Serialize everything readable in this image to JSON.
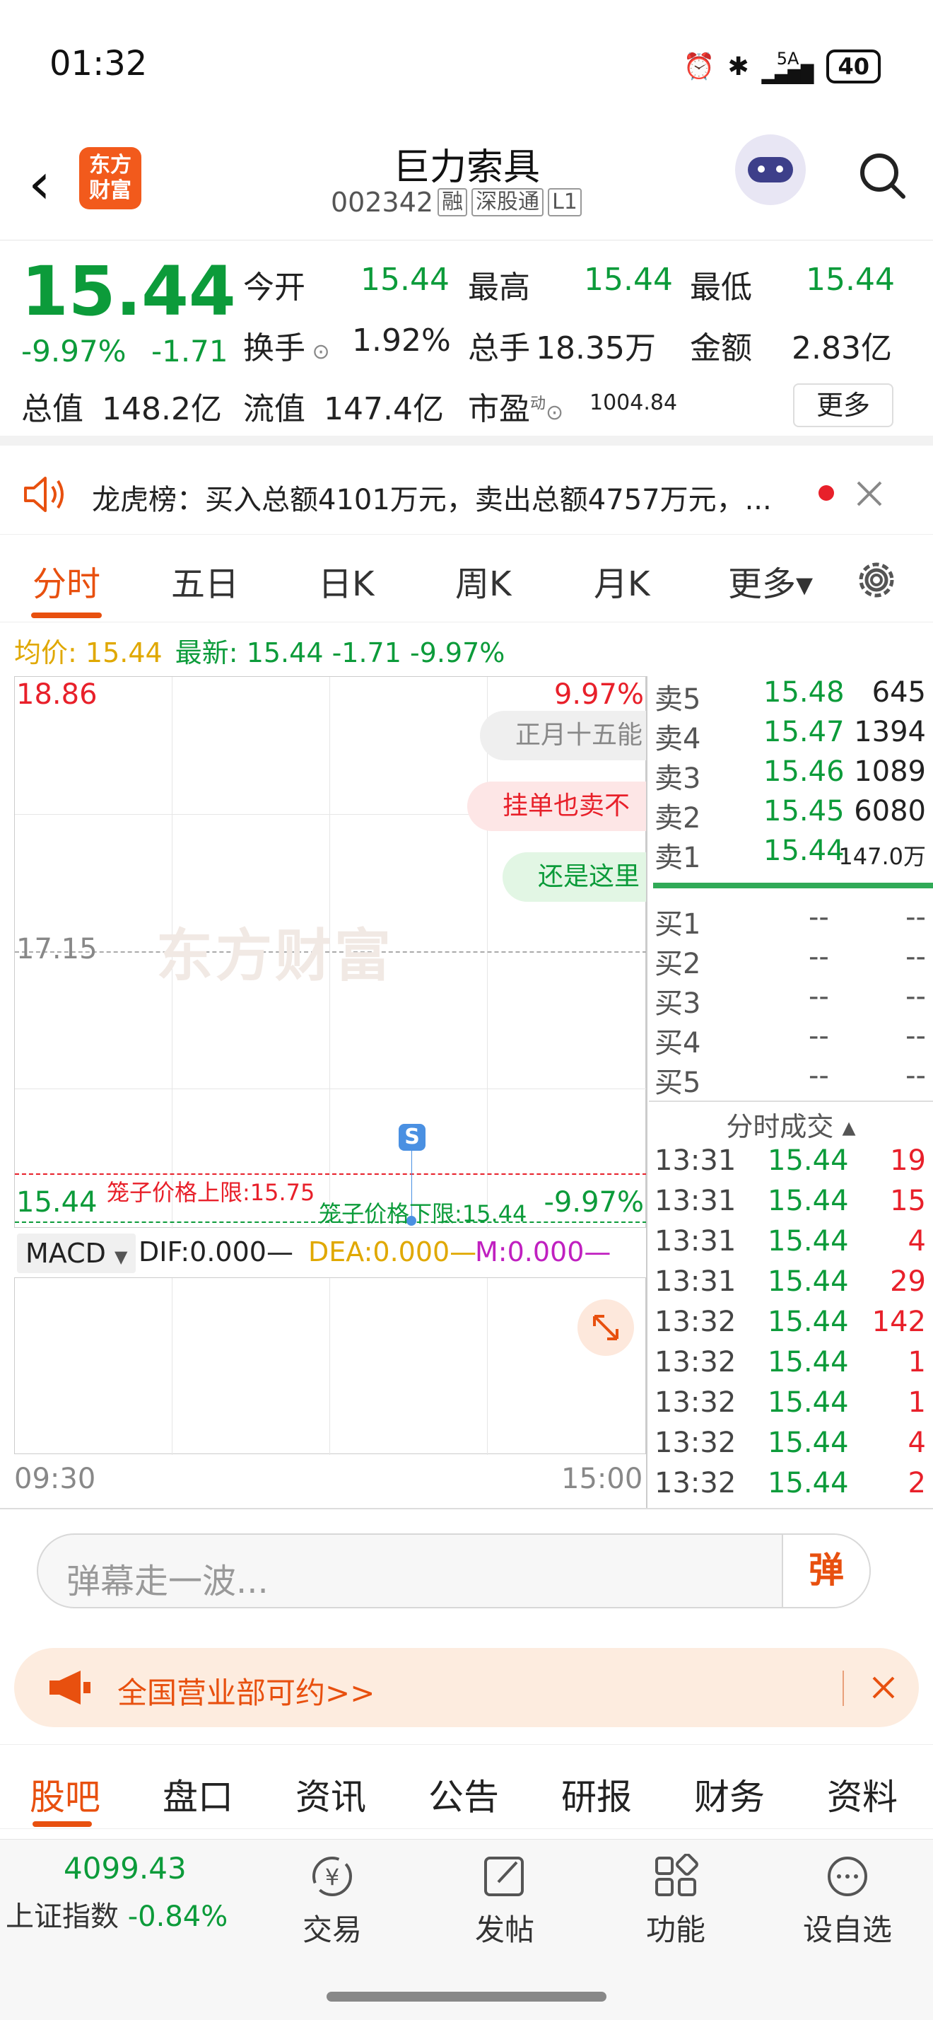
{
  "status": {
    "time": "01:32",
    "network": "5A",
    "battery": "40"
  },
  "header": {
    "back_glyph": "‹",
    "logo_line1": "东方",
    "logo_line2": "财富",
    "name": "巨力索具",
    "code": "002342",
    "tags": [
      "融",
      "深股通",
      "L1"
    ]
  },
  "quote": {
    "price": "15.44",
    "change_pct": "-9.97%",
    "change": "-1.71",
    "open_label": "今开",
    "open": "15.44",
    "high_label": "最高",
    "high": "15.44",
    "low_label": "最低",
    "low": "15.44",
    "turnover_label": "换手",
    "turnover": "1.92%",
    "volume_label": "总手",
    "volume": "18.35万",
    "amount_label": "金额",
    "amount": "2.83亿",
    "mcap_label": "总值",
    "mcap": "148.2亿",
    "float_label": "流值",
    "float": "147.4亿",
    "pe_label": "市盈",
    "pe_sup": "动",
    "pe": "1004.84",
    "more": "更多"
  },
  "notice": {
    "text": "龙虎榜：买入总额4101万元，卖出总额4757万元，..."
  },
  "tabs": [
    "分时",
    "五日",
    "日K",
    "周K",
    "月K",
    "更多▾"
  ],
  "avg": {
    "label": "均价:",
    "value": "15.44",
    "latest_label": "最新:",
    "latest": "15.44 -1.71 -9.97%"
  },
  "chart": {
    "top_price": "18.86",
    "top_pct": "9.97%",
    "mid_price": "17.15",
    "bottom_price": "15.44",
    "bottom_pct": "-9.97%",
    "watermark": "东方财富",
    "bubbles": [
      "正月十五能",
      "挂单也卖不",
      "还是这里"
    ],
    "upper_limit": "笼子价格上限:15.75",
    "lower_limit": "笼子价格下限:15.44",
    "s_marker": "S",
    "time_start": "09:30",
    "time_end": "15:00",
    "colors": {
      "up": "#e8202a",
      "down": "#0c9b3a",
      "accent": "#e8500f"
    }
  },
  "macd": {
    "selector": "MACD",
    "dif": "DIF:0.000—",
    "dea": "DEA:0.000—",
    "m": "M:0.000—"
  },
  "orderbook": {
    "asks": [
      {
        "label": "卖5",
        "price": "15.48",
        "vol": "645"
      },
      {
        "label": "卖4",
        "price": "15.47",
        "vol": "1394"
      },
      {
        "label": "卖3",
        "price": "15.46",
        "vol": "1089"
      },
      {
        "label": "卖2",
        "price": "15.45",
        "vol": "6080"
      },
      {
        "label": "卖1",
        "price": "15.44",
        "vol": "147.0万"
      }
    ],
    "bids": [
      {
        "label": "买1",
        "price": "--",
        "vol": "--"
      },
      {
        "label": "买2",
        "price": "--",
        "vol": "--"
      },
      {
        "label": "买3",
        "price": "--",
        "vol": "--"
      },
      {
        "label": "买4",
        "price": "--",
        "vol": "--"
      },
      {
        "label": "买5",
        "price": "--",
        "vol": "--"
      }
    ],
    "ticks_title": "分时成交 ▴",
    "ticks": [
      {
        "time": "13:31",
        "price": "15.44",
        "vol": "19"
      },
      {
        "time": "13:31",
        "price": "15.44",
        "vol": "15"
      },
      {
        "time": "13:31",
        "price": "15.44",
        "vol": "4"
      },
      {
        "time": "13:31",
        "price": "15.44",
        "vol": "29"
      },
      {
        "time": "13:32",
        "price": "15.44",
        "vol": "142"
      },
      {
        "time": "13:32",
        "price": "15.44",
        "vol": "1"
      },
      {
        "time": "13:32",
        "price": "15.44",
        "vol": "1"
      },
      {
        "time": "13:32",
        "price": "15.44",
        "vol": "4"
      },
      {
        "time": "13:32",
        "price": "15.44",
        "vol": "2"
      }
    ]
  },
  "danmu": {
    "placeholder": "弹幕走一波...",
    "button": "弹"
  },
  "promo": {
    "text": "全国营业部可约>>"
  },
  "bottom_tabs": [
    "股吧",
    "盘口",
    "资讯",
    "公告",
    "研报",
    "财务",
    "资料"
  ],
  "nav": {
    "index_value": "4099.43",
    "index_name": "上证指数",
    "index_change": "-0.84%",
    "items": [
      "交易",
      "发帖",
      "功能",
      "设自选"
    ]
  }
}
